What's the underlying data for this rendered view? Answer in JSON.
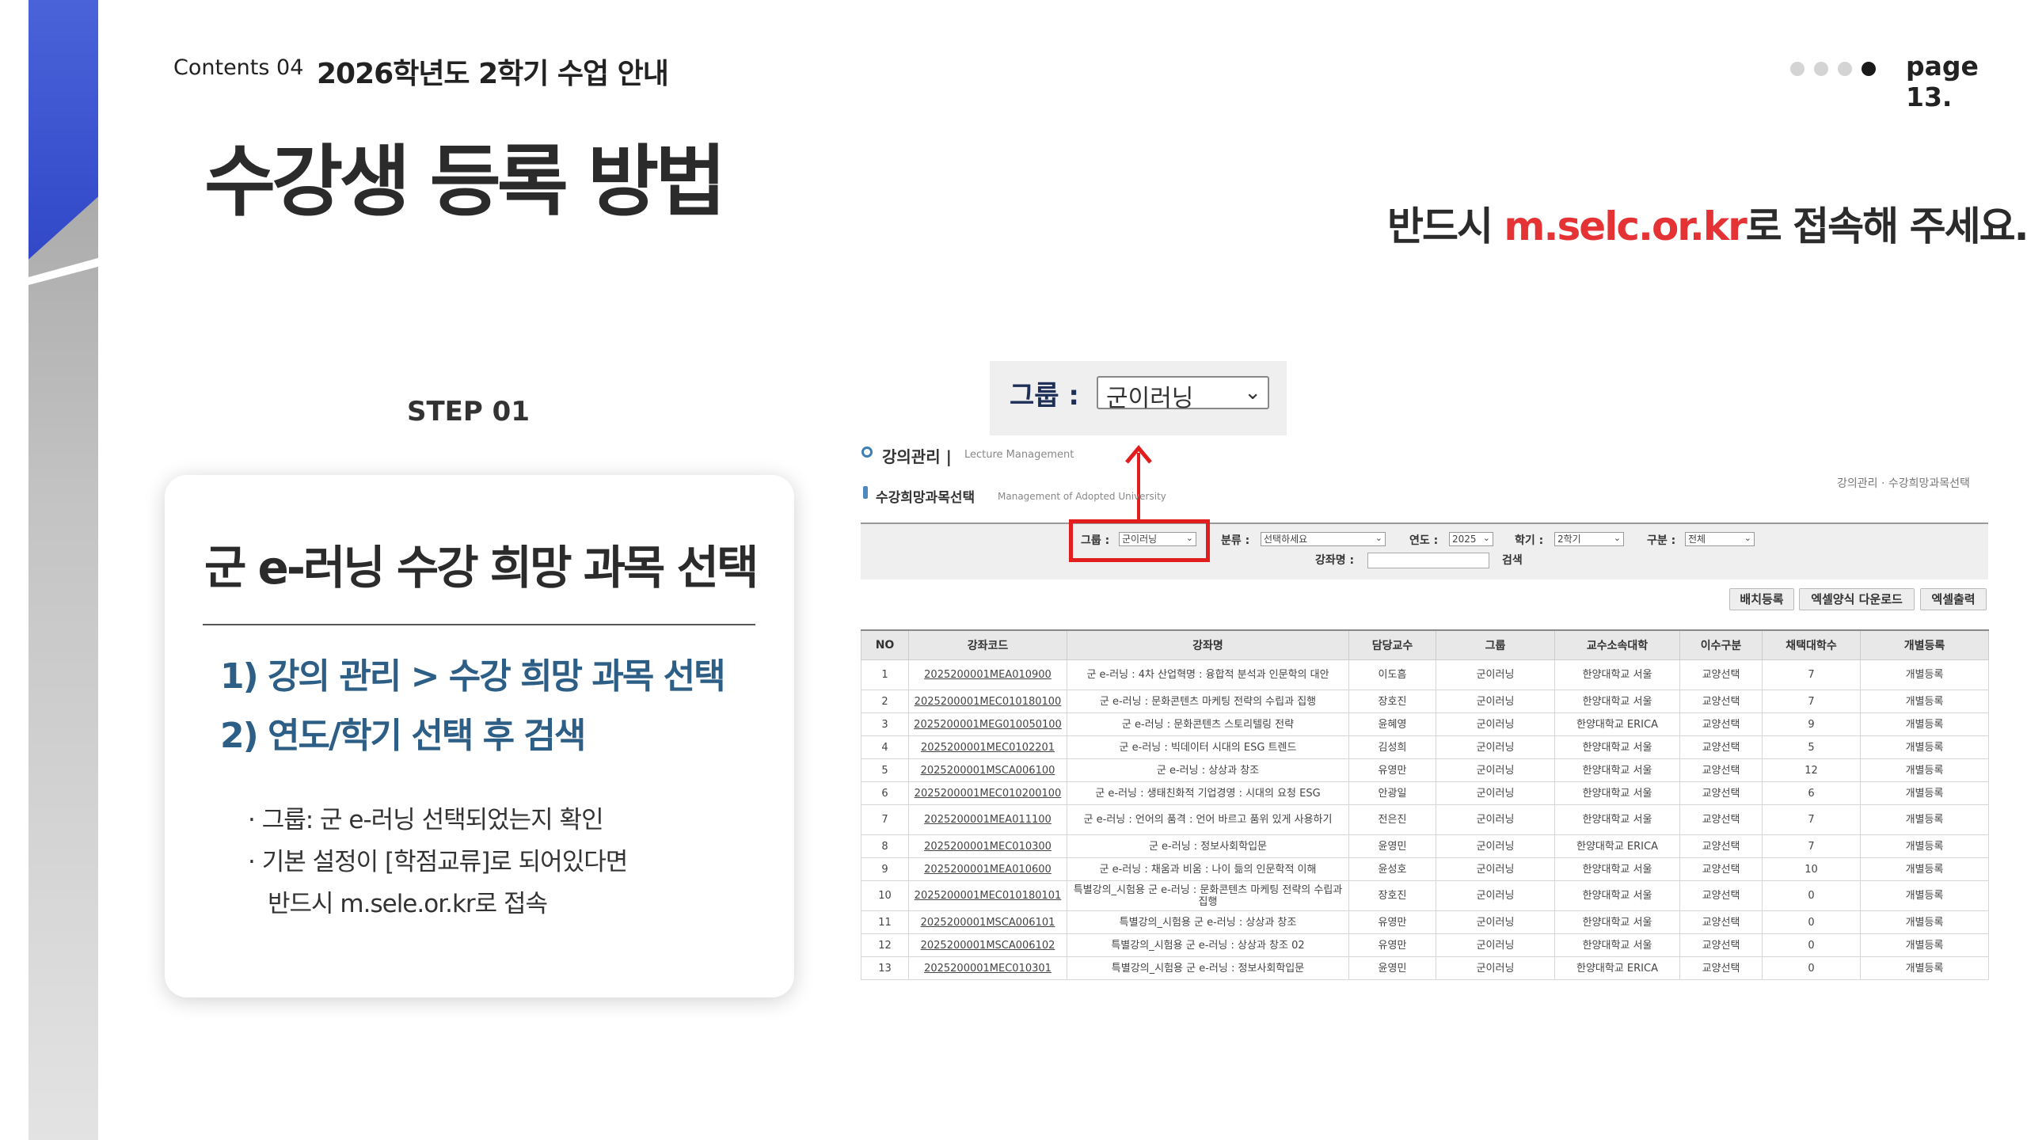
{
  "header": {
    "contents_label": "Contents 04",
    "contents_title": "2026학년도 2학기 수업 안내",
    "page_label": "page 13."
  },
  "main_title": "수강생 등록 방법",
  "notice": {
    "prefix": "반드시 ",
    "highlight": "m.selc.or.kr",
    "suffix": "로 접속해 주세요."
  },
  "step": "STEP 01",
  "card": {
    "title": "군 e-러닝 수강 희망 과목 선택",
    "sub1": "1) 강의 관리 > 수강 희망 과목 선택",
    "sub2": "2) 연도/학기 선택 후 검색",
    "notes": [
      "· 그룹: 군 e-러닝 선택되었는지 확인",
      "· 기본 설정이 [학점교류]로 되어있다면",
      "반드시 m.sele.or.kr로 접속"
    ]
  },
  "zoom": {
    "label": "그룹 :",
    "value": "군이러닝"
  },
  "screen": {
    "section_title": "강의관리 |",
    "section_sub": "Lecture Management",
    "page_title": "수강희망과목선택",
    "page_sub": "Management of Adopted University",
    "breadcrumb": "강의관리 · 수강희망과목선택",
    "filters": {
      "group_label": "그룹 :",
      "group_value": "군이러닝",
      "category_label": "분류 :",
      "category_value": "선택하세요",
      "year_label": "연도 :",
      "year_value": "2025",
      "term_label": "학기 :",
      "term_value": "2학기",
      "type_label": "구분 :",
      "type_value": "전체",
      "course_label": "강좌명 :",
      "search_label": "검색"
    },
    "buttons": {
      "batch": "배치등록",
      "excel_form": "엑셀양식 다운로드",
      "excel_out": "엑셀출력"
    },
    "columns": [
      "NO",
      "강좌코드",
      "강좌명",
      "담당교수",
      "그룹",
      "교수소속대학",
      "이수구분",
      "채택대학수",
      "개별등록"
    ],
    "rows": [
      [
        "1",
        "2025200001MEA010900",
        "군 e-러닝 : 4차 산업혁명 : 융합적 분석과 인문학의 대안",
        "이도흠",
        "군이러닝",
        "한양대학교 서울",
        "교양선택",
        "7",
        "개별등록"
      ],
      [
        "2",
        "2025200001MEC010180100",
        "군 e-러닝 : 문화콘텐츠 마케팅 전략의 수립과 집행",
        "장호진",
        "군이러닝",
        "한양대학교 서울",
        "교양선택",
        "7",
        "개별등록"
      ],
      [
        "3",
        "2025200001MEG010050100",
        "군 e-러닝 : 문화콘텐츠 스토리텔링 전략",
        "윤혜영",
        "군이러닝",
        "한양대학교 ERICA",
        "교양선택",
        "9",
        "개별등록"
      ],
      [
        "4",
        "2025200001MEC0102201",
        "군 e-러닝 : 빅데이터 시대의 ESG 트렌드",
        "김성희",
        "군이러닝",
        "한양대학교 서울",
        "교양선택",
        "5",
        "개별등록"
      ],
      [
        "5",
        "2025200001MSCA006100",
        "군 e-러닝 : 상상과 창조",
        "유영만",
        "군이러닝",
        "한양대학교 서울",
        "교양선택",
        "12",
        "개별등록"
      ],
      [
        "6",
        "2025200001MEC010200100",
        "군 e-러닝 : 생태친화적 기업경영 : 시대의 요청 ESG",
        "안광일",
        "군이러닝",
        "한양대학교 서울",
        "교양선택",
        "6",
        "개별등록"
      ],
      [
        "7",
        "2025200001MEA011100",
        "군 e-러닝 : 언어의 품격 : 언어 바르고 품위 있게 사용하기",
        "전은진",
        "군이러닝",
        "한양대학교 서울",
        "교양선택",
        "7",
        "개별등록"
      ],
      [
        "8",
        "2025200001MEC010300",
        "군 e-러닝 : 정보사회학입문",
        "윤영민",
        "군이러닝",
        "한양대학교 ERICA",
        "교양선택",
        "7",
        "개별등록"
      ],
      [
        "9",
        "2025200001MEA010600",
        "군 e-러닝 : 채움과 비움 : 나이 듦의 인문학적 이해",
        "윤성호",
        "군이러닝",
        "한양대학교 서울",
        "교양선택",
        "10",
        "개별등록"
      ],
      [
        "10",
        "2025200001MEC010180101",
        "특별강의_시험용 군 e-러닝 : 문화콘텐츠 마케팅 전략의 수립과 집행",
        "장호진",
        "군이러닝",
        "한양대학교 서울",
        "교양선택",
        "0",
        "개별등록"
      ],
      [
        "11",
        "2025200001MSCA006101",
        "특별강의_시험용 군 e-러닝 : 상상과 창조",
        "유영만",
        "군이러닝",
        "한양대학교 서울",
        "교양선택",
        "0",
        "개별등록"
      ],
      [
        "12",
        "2025200001MSCA006102",
        "특별강의_시험용 군 e-러닝 : 상상과 창조 02",
        "유영만",
        "군이러닝",
        "한양대학교 서울",
        "교양선택",
        "0",
        "개별등록"
      ],
      [
        "13",
        "2025200001MEC010301",
        "특별강의_시험용 군 e-러닝 : 정보사회학입문",
        "윤영민",
        "군이러닝",
        "한양대학교 ERICA",
        "교양선택",
        "0",
        "개별등록"
      ]
    ]
  },
  "icons": {
    "dropdown": "chevron-down-icon",
    "arrow": "arrow-up-icon"
  },
  "colors": {
    "accent_red": "#e53235",
    "blue_band": "#2f45c6",
    "sub_heading": "#2d5e86"
  }
}
